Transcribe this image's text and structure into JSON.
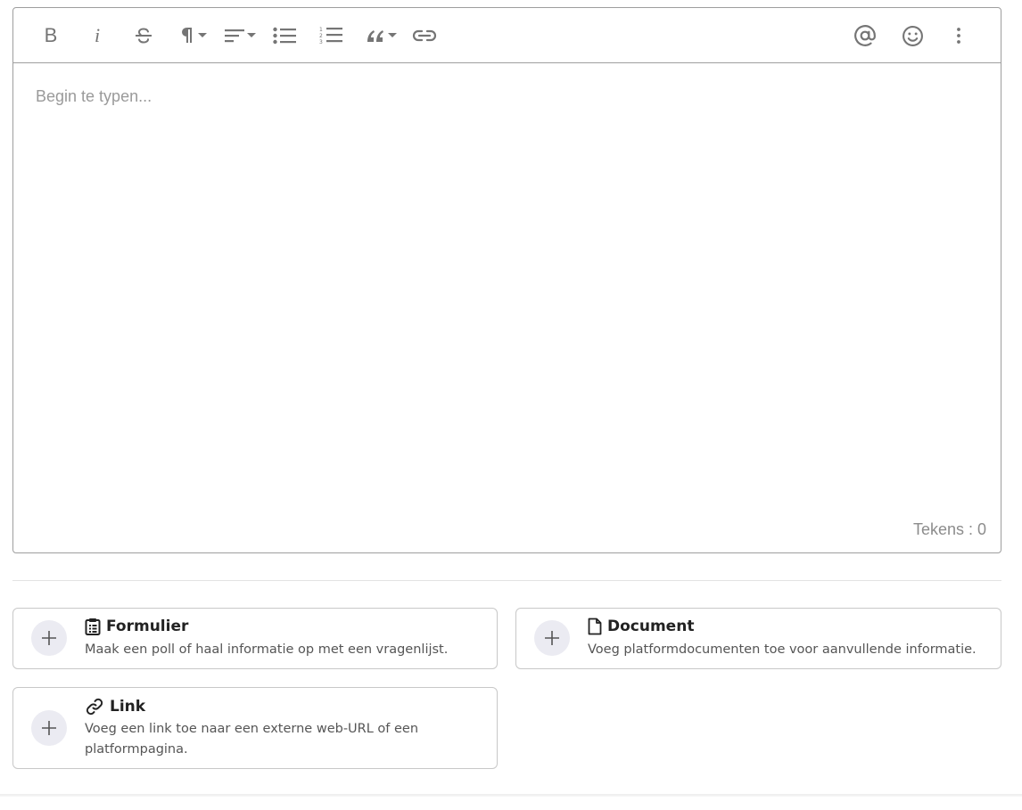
{
  "toolbar": {
    "bold_label": "B",
    "italic_label": "i",
    "buttons": [
      {
        "name": "bold-icon"
      },
      {
        "name": "italic-icon"
      },
      {
        "name": "strikethrough-icon"
      },
      {
        "name": "paragraph-icon"
      },
      {
        "name": "align-icon"
      },
      {
        "name": "bullet-list-icon"
      },
      {
        "name": "numbered-list-icon"
      },
      {
        "name": "quote-icon"
      },
      {
        "name": "link-icon"
      },
      {
        "name": "mention-icon"
      },
      {
        "name": "emoji-icon"
      },
      {
        "name": "more-vertical-icon"
      }
    ]
  },
  "editor": {
    "placeholder": "Begin te typen...",
    "counter": "Tekens : 0"
  },
  "attachments": [
    {
      "title": "Formulier",
      "icon": "clipboard-icon",
      "description": "Maak een poll of haal informatie op met een vragenlijst."
    },
    {
      "title": "Document",
      "icon": "document-icon",
      "description": "Voeg platformdocumenten toe voor aanvullende informatie."
    },
    {
      "title": "Link",
      "icon": "link-icon",
      "description_line1": "Voeg een link toe naar een externe web-URL of een",
      "description_line2": "platformpagina."
    }
  ],
  "colors": {
    "icon_gray": "#757575",
    "border": "#9e9e9e",
    "plus_circle": "#ebebf2"
  }
}
